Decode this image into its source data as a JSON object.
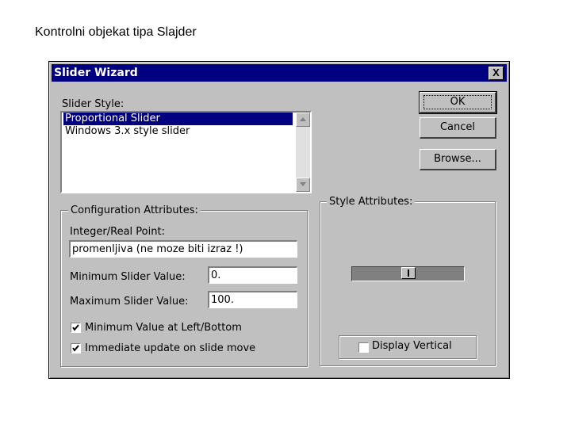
{
  "slide": {
    "title": "Kontrolni objekat tipa Slajder"
  },
  "window": {
    "title": "Slider Wizard",
    "close_glyph": "X"
  },
  "slider_style": {
    "label": "Slider Style:",
    "items": [
      "Proportional Slider",
      "Windows 3.x style slider"
    ],
    "selected_index": 0
  },
  "buttons": {
    "ok": "OK",
    "cancel": "Cancel",
    "browse": "Browse..."
  },
  "config": {
    "caption": "Configuration Attributes:",
    "point_label": "Integer/Real Point:",
    "point_value": "promenljiva (ne moze biti izraz !)",
    "min_label": "Minimum Slider Value:",
    "min_value": "0.",
    "max_label": "Maximum Slider Value:",
    "max_value": "100.",
    "checkbox_min_left": {
      "label": "Minimum Value at Left/Bottom",
      "checked": true
    },
    "checkbox_immediate": {
      "label": "Immediate update on slide move",
      "checked": true
    }
  },
  "style_attrs": {
    "caption": "Style Attributes:",
    "slider_level": 0.5,
    "display_vertical": {
      "label": "Display Vertical",
      "checked": false
    }
  },
  "colors": {
    "face": "#c0c0c0",
    "title_bar": "#000080",
    "selection": "#000080"
  },
  "icons": [
    "close-icon",
    "scroll-up-icon",
    "scroll-down-icon",
    "checkmark-icon"
  ]
}
